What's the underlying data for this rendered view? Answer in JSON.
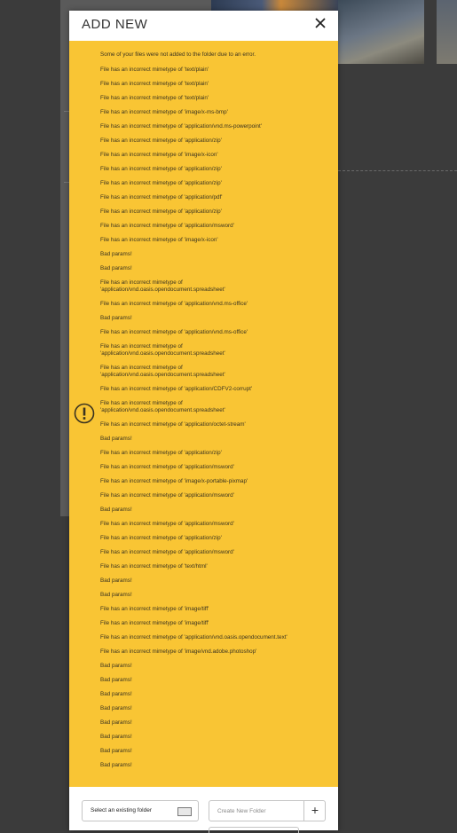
{
  "modal": {
    "title": "ADD NEW",
    "close_icon": "close-icon"
  },
  "error_panel": {
    "icon": "warning-icon",
    "intro": "Some of your files were not added to the folder due to an error.",
    "messages": [
      "File has an incorrect mimetype of 'text/plain'",
      "File has an incorrect mimetype of 'text/plain'",
      "File has an incorrect mimetype of 'text/plain'",
      "File has an incorrect mimetype of 'image/x-ms-bmp'",
      "File has an incorrect mimetype of 'application/vnd.ms-powerpoint'",
      "File has an incorrect mimetype of 'application/zip'",
      "File has an incorrect mimetype of 'image/x-icon'",
      "File has an incorrect mimetype of 'application/zip'",
      "File has an incorrect mimetype of 'application/zip'",
      "File has an incorrect mimetype of 'application/pdf'",
      "File has an incorrect mimetype of 'application/zip'",
      "File has an incorrect mimetype of 'application/msword'",
      "File has an incorrect mimetype of 'image/x-icon'",
      "Bad params!",
      "Bad params!",
      "File has an incorrect mimetype of\n'application/vnd.oasis.opendocument.spreadsheet'",
      "File has an incorrect mimetype of 'application/vnd.ms-office'",
      "Bad params!",
      "File has an incorrect mimetype of 'application/vnd.ms-office'",
      "File has an incorrect mimetype of\n'application/vnd.oasis.opendocument.spreadsheet'",
      "File has an incorrect mimetype of\n'application/vnd.oasis.opendocument.spreadsheet'",
      "File has an incorrect mimetype of 'application/CDFV2-corrupt'",
      "File has an incorrect mimetype of\n'application/vnd.oasis.opendocument.spreadsheet'",
      "File has an incorrect mimetype of 'application/octet-stream'",
      "Bad params!",
      "File has an incorrect mimetype of 'application/zip'",
      "File has an incorrect mimetype of 'application/msword'",
      "File has an incorrect mimetype of 'image/x-portable-pixmap'",
      "File has an incorrect mimetype of 'application/msword'",
      "Bad params!",
      "File has an incorrect mimetype of 'application/msword'",
      "File has an incorrect mimetype of 'application/zip'",
      "File has an incorrect mimetype of 'application/msword'",
      "File has an incorrect mimetype of 'text/html'",
      "Bad params!",
      "Bad params!",
      "File has an incorrect mimetype of 'image/tiff'",
      "File has an incorrect mimetype of 'image/tiff'",
      "File has an incorrect mimetype of 'application/vnd.oasis.opendocument.text'",
      "File has an incorrect mimetype of 'image/vnd.adobe.photoshop'",
      "Bad params!",
      "Bad params!",
      "Bad params!",
      "Bad params!",
      "Bad params!",
      "Bad params!",
      "Bad params!",
      "Bad params!"
    ]
  },
  "footer": {
    "select_folder_label": "Select an existing folder",
    "folder_icon": "folder-icon",
    "new_folder_placeholder": "Create New Folder",
    "new_folder_value": "",
    "add_folder_label": "+"
  },
  "colors": {
    "panel_bg": "#f9c534",
    "modal_bg": "#ffffff",
    "overlay_bg": "#3b3b3b",
    "text": "#3a3320"
  }
}
